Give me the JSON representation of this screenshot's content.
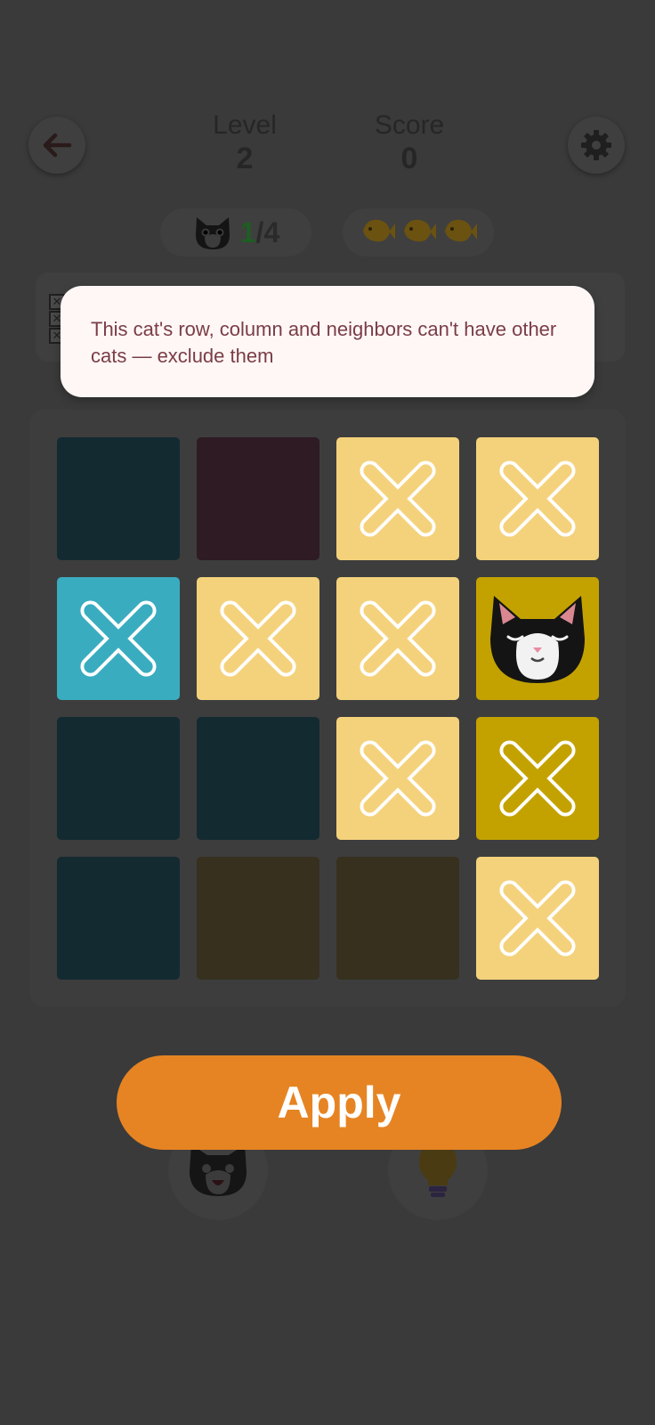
{
  "header": {
    "level_label": "Level",
    "level_value": "2",
    "score_label": "Score",
    "score_value": "0"
  },
  "progress": {
    "found": "1",
    "separator": "/",
    "total": "4"
  },
  "fish_count": 3,
  "tooltip": {
    "text": "This cat's row, column and neighbors can't have other cats — exclude them"
  },
  "board": {
    "rows": [
      [
        {
          "state": "empty",
          "color": "#132a31"
        },
        {
          "state": "empty",
          "color": "#2e1b23"
        },
        {
          "state": "excluded",
          "color": "#f4d27c"
        },
        {
          "state": "excluded",
          "color": "#f4d27c"
        }
      ],
      [
        {
          "state": "excluded",
          "color": "#3aacbf"
        },
        {
          "state": "excluded",
          "color": "#f4d27c"
        },
        {
          "state": "excluded",
          "color": "#f4d27c"
        },
        {
          "state": "cat",
          "color": "#c3a200"
        }
      ],
      [
        {
          "state": "empty",
          "color": "#132a31"
        },
        {
          "state": "empty",
          "color": "#132a31"
        },
        {
          "state": "excluded",
          "color": "#f4d27c"
        },
        {
          "state": "excluded",
          "color": "#c3a200"
        }
      ],
      [
        {
          "state": "empty",
          "color": "#132a31"
        },
        {
          "state": "empty",
          "color": "#37301f"
        },
        {
          "state": "empty",
          "color": "#37301f"
        },
        {
          "state": "excluded",
          "color": "#f4d27c"
        }
      ]
    ]
  },
  "apply_label": "Apply",
  "colors": {
    "accent": "#e68423",
    "overlay": "#3a3a3a",
    "tooltip_bg": "#fff7f6",
    "tooltip_text": "#7a3d45"
  },
  "icons": {
    "back": "back-arrow-icon",
    "settings": "gear-icon",
    "hint": "lightbulb-icon",
    "cat_helper": "cat-helper-icon"
  }
}
